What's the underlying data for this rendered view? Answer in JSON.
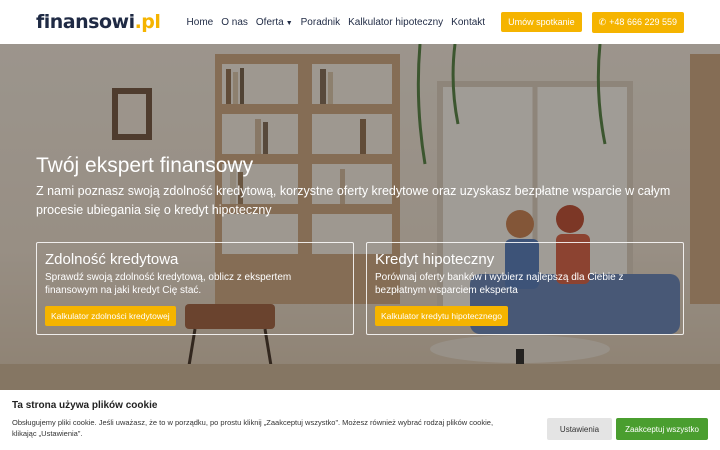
{
  "header": {
    "logo_main": "finansowi",
    "logo_tld": ".pl",
    "nav": [
      {
        "label": "Home"
      },
      {
        "label": "O nas"
      },
      {
        "label": "Oferta"
      },
      {
        "label": "Poradnik"
      },
      {
        "label": "Kalkulator hipoteczny"
      },
      {
        "label": "Kontakt"
      }
    ],
    "appointment_label": "Umów spotkanie",
    "phone_label": "+48 666 229 559"
  },
  "hero": {
    "title": "Twój ekspert finansowy",
    "subtitle": "Z nami poznasz swoją zdolność kredytową, korzystne oferty kredytowe oraz uzyskasz bezpłatne wsparcie w całym procesie ubiegania się o kredyt hipoteczny",
    "cards": [
      {
        "title": "Zdolność kredytowa",
        "desc": "Sprawdź swoją zdolność kredytową, oblicz z ekspertem finansowym na jaki kredyt Cię stać.",
        "button": "Kalkulator zdolności kredytowej"
      },
      {
        "title": "Kredyt hipoteczny",
        "desc": "Porównaj oferty banków i wybierz najlepszą dla Ciebie z bezpłatnym wsparciem eksperta",
        "button": "Kalkulator kredytu hipotecznego"
      }
    ]
  },
  "cookie": {
    "title": "Ta strona używa plików cookie",
    "text": "Obsługujemy pliki cookie. Jeśli uważasz, że to w porządku, po prostu kliknij „Zaakceptuj wszystko”. Możesz również wybrać rodzaj plików cookie, klikając „Ustawienia”.",
    "settings_label": "Ustawienia",
    "accept_label": "Zaakceptuj wszystko"
  },
  "colors": {
    "accent": "#f5b400",
    "navy": "#1f2a44",
    "accept_green": "#4a9e2f"
  }
}
